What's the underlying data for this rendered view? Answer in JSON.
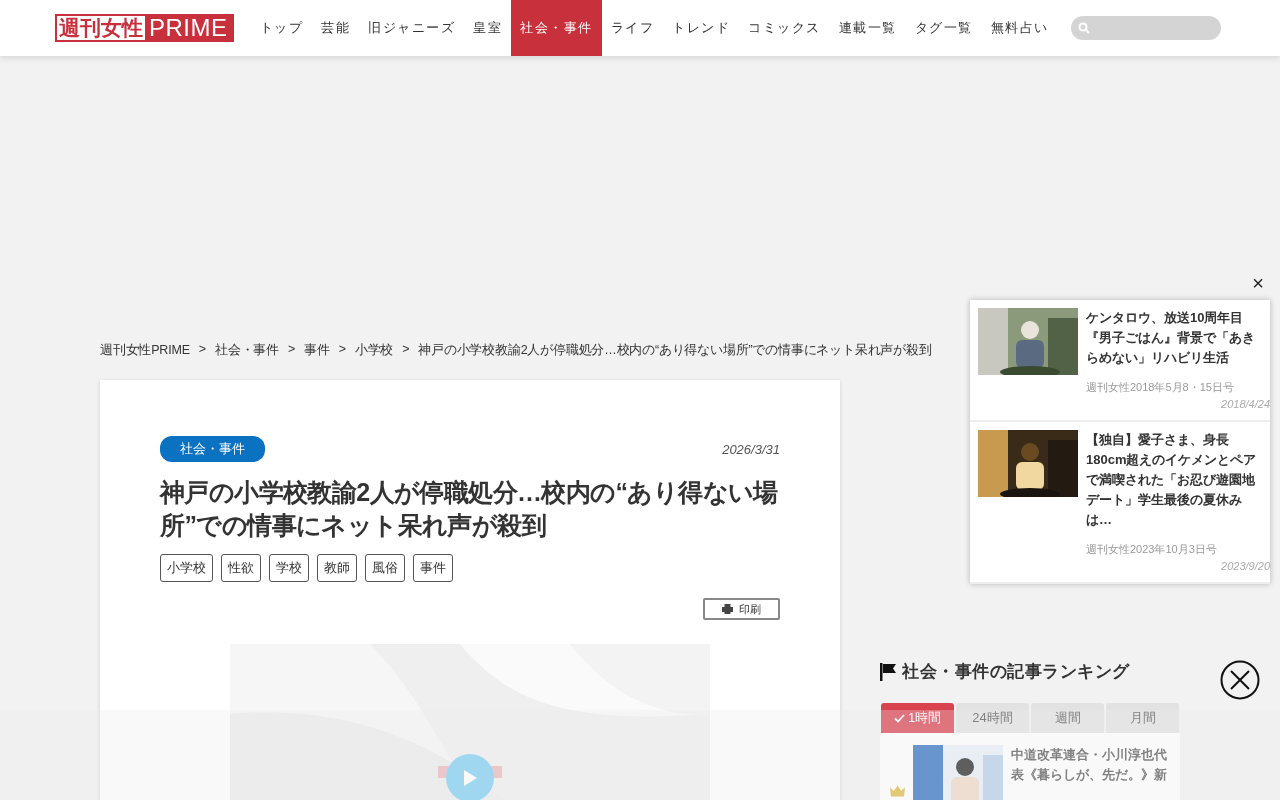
{
  "header": {
    "logo": {
      "part1": "週刊女性",
      "part2": "PRIME"
    },
    "nav": [
      {
        "label": "トップ",
        "selected": false
      },
      {
        "label": "芸能",
        "selected": false
      },
      {
        "label": "旧ジャニーズ",
        "selected": false
      },
      {
        "label": "皇室",
        "selected": false
      },
      {
        "label": "社会・事件",
        "selected": true
      },
      {
        "label": "ライフ",
        "selected": false
      },
      {
        "label": "トレンド",
        "selected": false
      },
      {
        "label": "コミックス",
        "selected": false
      },
      {
        "label": "連載一覧",
        "selected": false
      },
      {
        "label": "タグ一覧",
        "selected": false
      },
      {
        "label": "無料占い",
        "selected": false
      }
    ]
  },
  "breadcrumb": [
    "週刊女性PRIME",
    "社会・事件",
    "事件",
    "小学校",
    "神戸の小学校教諭2人が停職処分…校内の“あり得ない場所”での情事にネット呆れ声が殺到"
  ],
  "breadcrumb_separator": ">",
  "article": {
    "category": "社会・事件",
    "date": "2026/3/31",
    "title": "神戸の小学校教諭2人が停職処分…校内の“あり得ない場所”での情事にネット呆れ声が殺到",
    "tags": [
      "小学校",
      "性欲",
      "学校",
      "教師",
      "風俗",
      "事件"
    ],
    "print_label": "印刷"
  },
  "popup": {
    "close": "×",
    "items": [
      {
        "title": "ケンタロウ、放送10周年目『男子ごはん』背景で「あきらめない」リハビリ生活",
        "issue": "週刊女性2018年5月8・15日号",
        "date": "2018/4/24"
      },
      {
        "title": "【独自】愛子さま、身長180cm超えのイケメンとペアで満喫された「お忍び遊園地デート」学生最後の夏休みは…",
        "issue": "週刊女性2023年10月3日号",
        "date": "2023/9/20"
      }
    ]
  },
  "ranking": {
    "title": "社会・事件の記事ランキング",
    "tabs": [
      {
        "label": "1時間",
        "selected": true
      },
      {
        "label": "24時間",
        "selected": false
      },
      {
        "label": "週間",
        "selected": false
      },
      {
        "label": "月間",
        "selected": false
      }
    ],
    "items": [
      {
        "title": "中道改革連合・小川淳也代表《暮らしが、先だ。》新"
      }
    ]
  }
}
